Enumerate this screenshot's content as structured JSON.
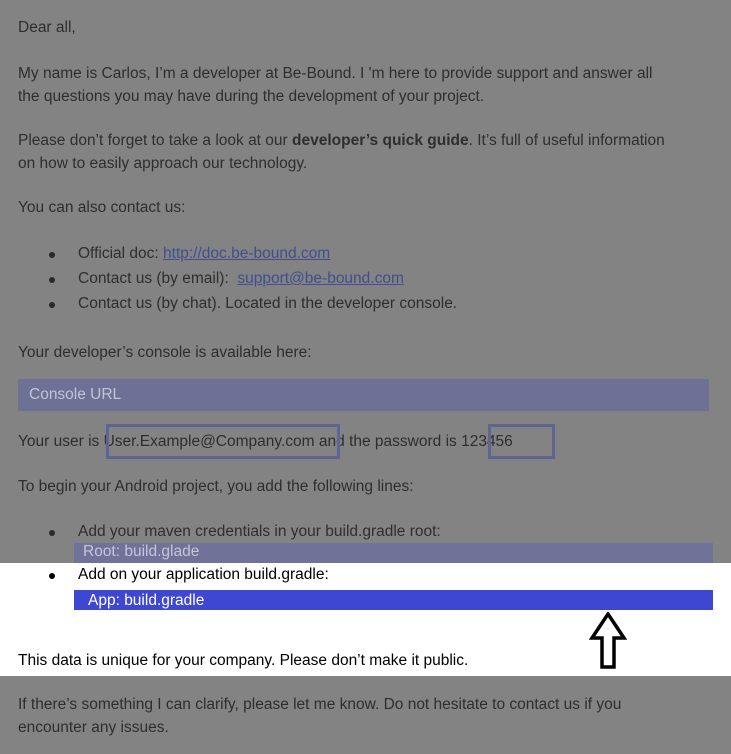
{
  "greeting": "Dear all,",
  "intro": {
    "line1": "My name is Carlos, I’m a developer at Be-Bound. I 'm here to provide support and answer all",
    "line2": "the questions you may have during the development of your project."
  },
  "guide": {
    "line1_pre": "Please don’t forget to take a look at our ",
    "line1_bold": "developer’s quick guide",
    "line1_post": ". It’s full of useful information",
    "line2": "on how to easily approach our technology."
  },
  "contact_heading": "You can also contact us:",
  "contacts": [
    {
      "label": "Official doc: ",
      "link": "http://doc.be-bound.com"
    },
    {
      "label": "Contact us (by email):  ",
      "link": "support@be-bound.com"
    },
    {
      "label": "Contact us (by chat). Located in the developer console."
    }
  ],
  "console_intro": "Your developer’s console is available here:",
  "console_url_label": "Console URL",
  "credentials": {
    "pre": "Your user is ",
    "user": "User.Example@Company.com",
    "mid": " and the password is ",
    "password": "123456"
  },
  "android_intro": "To begin your Android project, you add the following lines:",
  "steps": [
    {
      "text": "Add your maven credentials in your build.gradle root:",
      "bar": "Root: build.glade"
    },
    {
      "text": "Add on your application build.gradle:",
      "bar": "App: build.gradle"
    }
  ],
  "notice": "This data is unique for your company. Please don’t make it public.",
  "closing": {
    "line1": "If there’s something I can clarify, please let me know. Do not hesitate to contact us if you",
    "line2": "encounter any issues."
  },
  "colors": {
    "dim_overlay": "#838383",
    "console_bar": "#6d7196",
    "root_bar": "#6f7299",
    "app_bar": "#3e47d2"
  },
  "icons": {
    "pointer": "up-arrow-icon"
  }
}
